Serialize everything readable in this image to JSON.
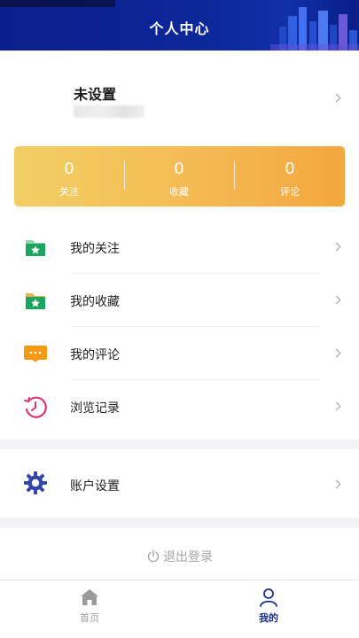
{
  "header": {
    "title": "个人中心"
  },
  "profile": {
    "name": "未设置"
  },
  "stats": [
    {
      "value": "0",
      "label": "关注"
    },
    {
      "value": "0",
      "label": "收藏"
    },
    {
      "value": "0",
      "label": "评论"
    }
  ],
  "menu": {
    "items": [
      {
        "label": "我的关注",
        "icon": "folder-star-icon"
      },
      {
        "label": "我的收藏",
        "icon": "folder-star-icon"
      },
      {
        "label": "我的评论",
        "icon": "comment-icon"
      },
      {
        "label": "浏览记录",
        "icon": "history-icon"
      }
    ],
    "settings": {
      "label": "账户设置",
      "icon": "gear-icon"
    }
  },
  "logout": {
    "label": "退出登录"
  },
  "tabbar": {
    "tabs": [
      {
        "label": "首页",
        "icon": "home-icon",
        "active": false
      },
      {
        "label": "我的",
        "icon": "user-icon",
        "active": true
      }
    ]
  },
  "colors": {
    "header": "#0d2699",
    "stats_start": "#f2cf63",
    "stats_end": "#f3a73f",
    "folder_green": "#1aa561",
    "comment_orange": "#f39a14",
    "history_pink": "#d8376a",
    "gear_blue": "#3345a8",
    "tab_active": "#1c2e8c",
    "tab_inactive": "#9b9b9b"
  }
}
